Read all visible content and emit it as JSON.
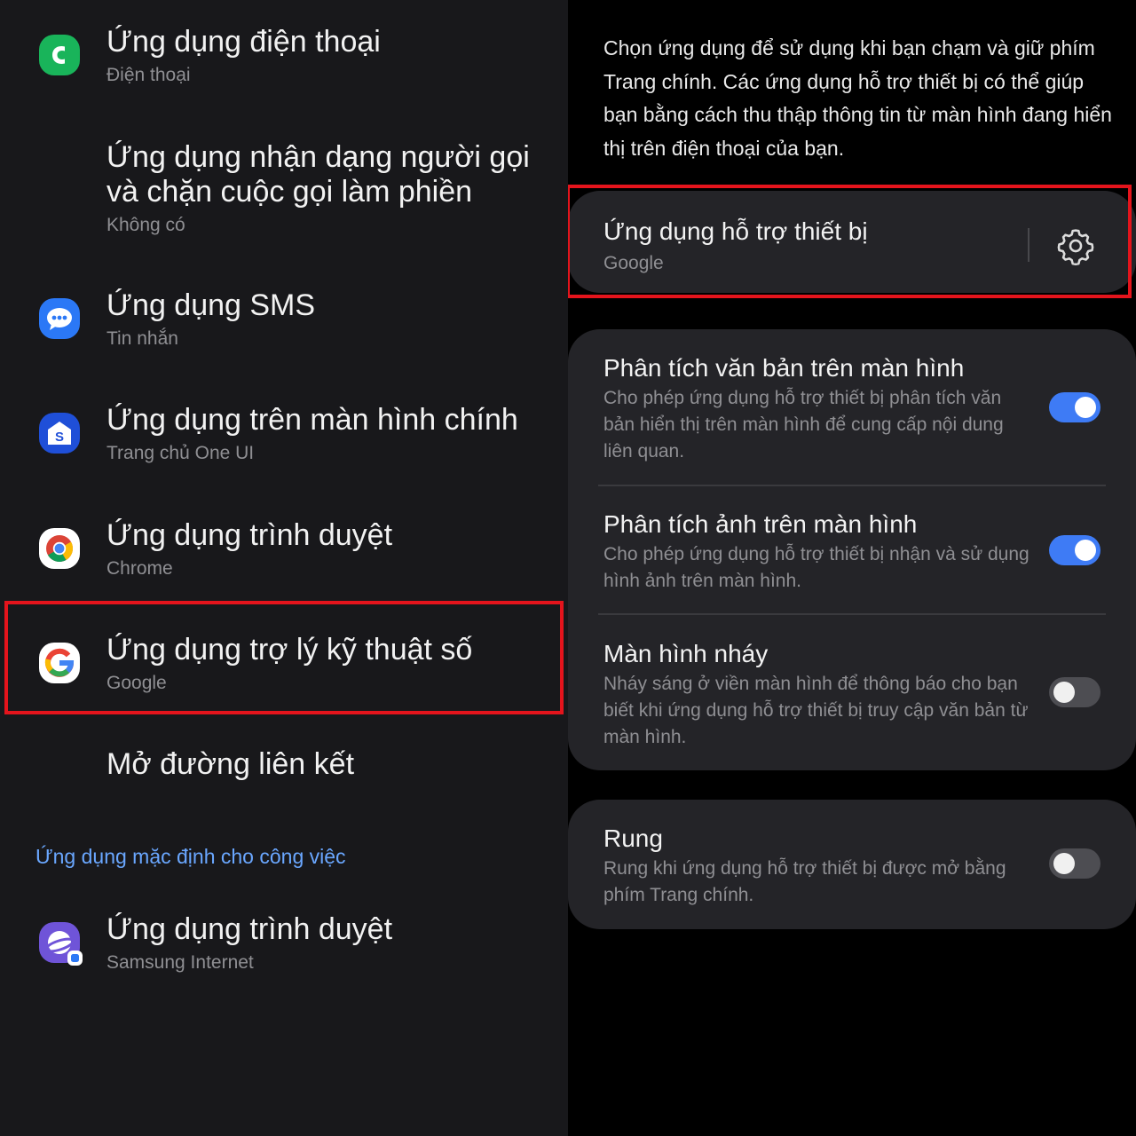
{
  "left_panel": {
    "items": [
      {
        "title": "Ứng dụng điện thoại",
        "subtitle": "Điện thoại",
        "icon": "phone-icon"
      },
      {
        "title_line1": "Ứng dụng nhận dạng người gọi",
        "title_line2": "và chặn cuộc gọi làm phiền",
        "subtitle": "Không có"
      },
      {
        "title": "Ứng dụng SMS",
        "subtitle": "Tin nhắn",
        "icon": "messages-icon"
      },
      {
        "title": "Ứng dụng trên màn hình chính",
        "subtitle": "Trang chủ One UI",
        "icon": "samsung-home-icon"
      },
      {
        "title": "Ứng dụng trình duyệt",
        "subtitle": "Chrome",
        "icon": "chrome-icon"
      },
      {
        "title": "Ứng dụng trợ lý kỹ thuật số",
        "subtitle": "Google",
        "icon": "google-icon",
        "highlighted": true
      },
      {
        "title": "Mở đường liên kết"
      }
    ],
    "work_section": {
      "header": "Ứng dụng mặc định cho công việc",
      "items": [
        {
          "title": "Ứng dụng trình duyệt",
          "subtitle": "Samsung Internet",
          "icon": "samsung-internet-icon"
        }
      ]
    }
  },
  "right_panel": {
    "description": "Chọn ứng dụng để sử dụng khi bạn chạm và giữ phím Trang chính. Các ứng dụng hỗ trợ thiết bị có thể giúp bạn bằng cách thu thập thông tin từ màn hình đang hiển thị trên điện thoại của bạn.",
    "assist_app": {
      "title": "Ứng dụng hỗ trợ thiết bị",
      "subtitle": "Google",
      "icon": "gear-icon",
      "highlighted": true
    },
    "settings": [
      {
        "title": "Phân tích văn bản trên màn hình",
        "description": "Cho phép ứng dụng hỗ trợ thiết bị phân tích văn bản hiển thị trên màn hình để cung cấp nội dung liên quan.",
        "enabled": true
      },
      {
        "title": "Phân tích ảnh trên màn hình",
        "description": "Cho phép ứng dụng hỗ trợ thiết bị nhận và sử dụng hình ảnh trên màn hình.",
        "enabled": true
      },
      {
        "title": "Màn hình nháy",
        "description": "Nháy sáng ở viền màn hình để thông báo cho bạn biết khi ứng dụng hỗ trợ thiết bị truy cập văn bản từ màn hình.",
        "enabled": false
      }
    ],
    "vibration": {
      "title": "Rung",
      "description": "Rung khi ứng dụng hỗ trợ thiết bị được mở bằng phím Trang chính.",
      "enabled": false
    }
  },
  "colors": {
    "accent_blue": "#3e7bf5",
    "highlight_red": "#e4141c",
    "section_header": "#6aa7ff"
  }
}
